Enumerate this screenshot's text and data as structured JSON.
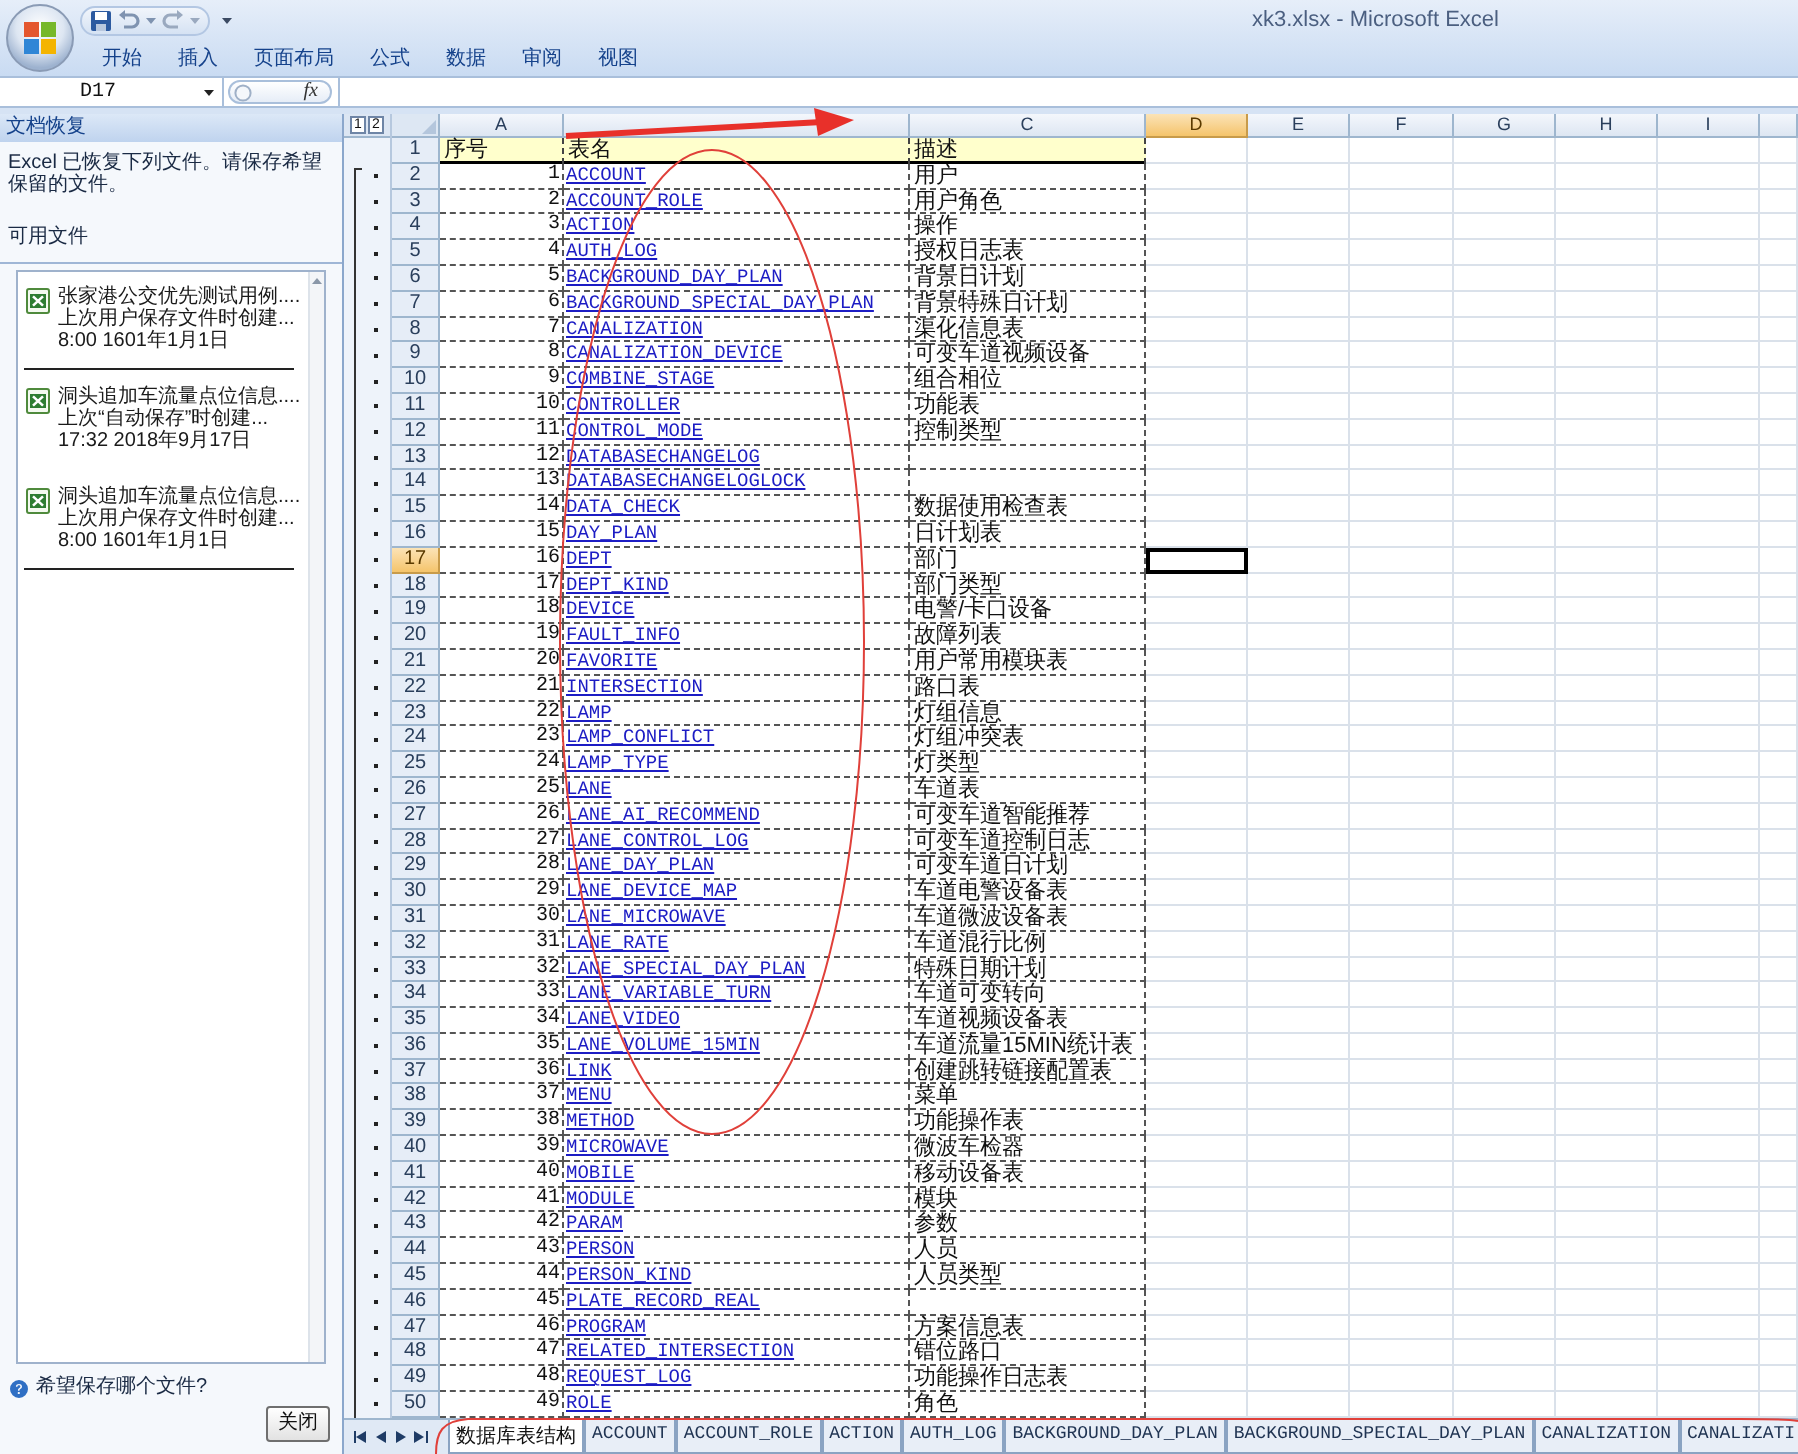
{
  "window": {
    "title": "xk3.xlsx - Microsoft Excel"
  },
  "ribbon_tabs": [
    {
      "label": "开始",
      "selected": false
    },
    {
      "label": "插入",
      "selected": false
    },
    {
      "label": "页面布局",
      "selected": false
    },
    {
      "label": "公式",
      "selected": false
    },
    {
      "label": "数据",
      "selected": false
    },
    {
      "label": "审阅",
      "selected": false
    },
    {
      "label": "视图",
      "selected": false
    }
  ],
  "formula_bar": {
    "name_box": "D17",
    "function_button": "fx"
  },
  "recovery_pane": {
    "title": "文档恢复",
    "message": "Excel 已恢复下列文件。请保存希望保留的文件。",
    "list_label": "可用文件",
    "files": [
      {
        "name": "张家港公交优先测试用例....",
        "status": "上次用户保存文件时创建...",
        "time": "8:00 1601年1月1日",
        "divider_after": true
      },
      {
        "name": "洞头追加车流量点位信息....",
        "status": "上次“自动保存”时创建...",
        "time": "17:32 2018年9月17日",
        "divider_after": false
      },
      {
        "name": "洞头追加车流量点位信息....",
        "status": "上次用户保存文件时创建...",
        "time": "8:00 1601年1月1日",
        "divider_after": true
      }
    ],
    "question": "希望保存哪个文件?",
    "close_button": "关闭"
  },
  "sheet": {
    "outline_levels": [
      "1",
      "2"
    ],
    "columns": [
      {
        "label": "A",
        "selected": false
      },
      {
        "selected": false
      },
      {
        "label": "C",
        "selected": false
      },
      {
        "label": "D",
        "selected": true
      },
      {
        "label": "E",
        "selected": false
      },
      {
        "label": "F",
        "selected": false
      },
      {
        "label": "G",
        "selected": false
      },
      {
        "label": "H",
        "selected": false
      },
      {
        "label": "I",
        "selected": false
      },
      {
        "selected": false
      }
    ],
    "rows": [
      {
        "number": "1",
        "selected": false,
        "kind": "header",
        "cells": [
          "序号",
          "表名",
          "描述"
        ]
      },
      {
        "number": "2",
        "selected": false,
        "kind": "data",
        "no": "1",
        "name": "ACCOUNT",
        "desc": "用户"
      },
      {
        "number": "3",
        "selected": false,
        "kind": "data",
        "no": "2",
        "name": "ACCOUNT_ROLE",
        "desc": "用户角色"
      },
      {
        "number": "4",
        "selected": false,
        "kind": "data",
        "no": "3",
        "name": "ACTION",
        "desc": "操作"
      },
      {
        "number": "5",
        "selected": false,
        "kind": "data",
        "no": "4",
        "name": "AUTH_LOG",
        "desc": "授权日志表"
      },
      {
        "number": "6",
        "selected": false,
        "kind": "data",
        "no": "5",
        "name": "BACKGROUND_DAY_PLAN",
        "desc": "背景日计划"
      },
      {
        "number": "7",
        "selected": false,
        "kind": "data",
        "no": "6",
        "name": "BACKGROUND_SPECIAL_DAY_PLAN",
        "desc": "背景特殊日计划"
      },
      {
        "number": "8",
        "selected": false,
        "kind": "data",
        "no": "7",
        "name": "CANALIZATION",
        "desc": "渠化信息表"
      },
      {
        "number": "9",
        "selected": false,
        "kind": "data",
        "no": "8",
        "name": "CANALIZATION_DEVICE",
        "desc": "可变车道视频设备"
      },
      {
        "number": "10",
        "selected": false,
        "kind": "data",
        "no": "9",
        "name": "COMBINE_STAGE",
        "desc": "组合相位"
      },
      {
        "number": "11",
        "selected": false,
        "kind": "data",
        "no": "10",
        "name": "CONTROLLER",
        "desc": "功能表"
      },
      {
        "number": "12",
        "selected": false,
        "kind": "data",
        "no": "11",
        "name": "CONTROL_MODE",
        "desc": "控制类型"
      },
      {
        "number": "13",
        "selected": false,
        "kind": "data",
        "no": "12",
        "name": "DATABASECHANGELOG"
      },
      {
        "number": "14",
        "selected": false,
        "kind": "data",
        "no": "13",
        "name": "DATABASECHANGELOGLOCK"
      },
      {
        "number": "15",
        "selected": false,
        "kind": "data",
        "no": "14",
        "name": "DATA_CHECK",
        "desc": "数据使用检查表"
      },
      {
        "number": "16",
        "selected": false,
        "kind": "data",
        "no": "15",
        "name": "DAY_PLAN",
        "desc": "日计划表"
      },
      {
        "number": "17",
        "selected": true,
        "kind": "data",
        "no": "16",
        "name": "DEPT",
        "desc": "部门"
      },
      {
        "number": "18",
        "selected": false,
        "kind": "data",
        "no": "17",
        "name": "DEPT_KIND",
        "desc": "部门类型"
      },
      {
        "number": "19",
        "selected": false,
        "kind": "data",
        "no": "18",
        "name": "DEVICE",
        "desc": "电警/卡口设备"
      },
      {
        "number": "20",
        "selected": false,
        "kind": "data",
        "no": "19",
        "name": "FAULT_INFO",
        "desc": "故障列表"
      },
      {
        "number": "21",
        "selected": false,
        "kind": "data",
        "no": "20",
        "name": "FAVORITE",
        "desc": "用户常用模块表"
      },
      {
        "number": "22",
        "selected": false,
        "kind": "data",
        "no": "21",
        "name": "INTERSECTION",
        "desc": "路口表"
      },
      {
        "number": "23",
        "selected": false,
        "kind": "data",
        "no": "22",
        "name": "LAMP",
        "desc": "灯组信息"
      },
      {
        "number": "24",
        "selected": false,
        "kind": "data",
        "no": "23",
        "name": "LAMP_CONFLICT",
        "desc": "灯组冲突表"
      },
      {
        "number": "25",
        "selected": false,
        "kind": "data",
        "no": "24",
        "name": "LAMP_TYPE",
        "desc": "灯类型"
      },
      {
        "number": "26",
        "selected": false,
        "kind": "data",
        "no": "25",
        "name": "LANE",
        "desc": "车道表"
      },
      {
        "number": "27",
        "selected": false,
        "kind": "data",
        "no": "26",
        "name": "LANE_AI_RECOMMEND",
        "desc": "可变车道智能推荐"
      },
      {
        "number": "28",
        "selected": false,
        "kind": "data",
        "no": "27",
        "name": "LANE_CONTROL_LOG",
        "desc": "可变车道控制日志"
      },
      {
        "number": "29",
        "selected": false,
        "kind": "data",
        "no": "28",
        "name": "LANE_DAY_PLAN",
        "desc": "可变车道日计划"
      },
      {
        "number": "30",
        "selected": false,
        "kind": "data",
        "no": "29",
        "name": "LANE_DEVICE_MAP",
        "desc": "车道电警设备表"
      },
      {
        "number": "31",
        "selected": false,
        "kind": "data",
        "no": "30",
        "name": "LANE_MICROWAVE",
        "desc": "车道微波设备表"
      },
      {
        "number": "32",
        "selected": false,
        "kind": "data",
        "no": "31",
        "name": "LANE_RATE",
        "desc": "车道混行比例"
      },
      {
        "number": "33",
        "selected": false,
        "kind": "data",
        "no": "32",
        "name": "LANE_SPECIAL_DAY_PLAN",
        "desc": "特殊日期计划"
      },
      {
        "number": "34",
        "selected": false,
        "kind": "data",
        "no": "33",
        "name": "LANE_VARIABLE_TURN",
        "desc": "车道可变转向"
      },
      {
        "number": "35",
        "selected": false,
        "kind": "data",
        "no": "34",
        "name": "LANE_VIDEO",
        "desc": "车道视频设备表"
      },
      {
        "number": "36",
        "selected": false,
        "kind": "data",
        "no": "35",
        "name": "LANE_VOLUME_15MIN",
        "desc": "车道流量15MIN统计表"
      },
      {
        "number": "37",
        "selected": false,
        "kind": "data",
        "no": "36",
        "name": "LINK",
        "desc": "创建跳转链接配置表"
      },
      {
        "number": "38",
        "selected": false,
        "kind": "data",
        "no": "37",
        "name": "MENU",
        "desc": "菜单"
      },
      {
        "number": "39",
        "selected": false,
        "kind": "data",
        "no": "38",
        "name": "METHOD",
        "desc": "功能操作表"
      },
      {
        "number": "40",
        "selected": false,
        "kind": "data",
        "no": "39",
        "name": "MICROWAVE",
        "desc": "微波车检器"
      },
      {
        "number": "41",
        "selected": false,
        "kind": "data",
        "no": "40",
        "name": "MOBILE",
        "desc": "移动设备表"
      },
      {
        "number": "42",
        "selected": false,
        "kind": "data",
        "no": "41",
        "name": "MODULE",
        "desc": "模块"
      },
      {
        "number": "43",
        "selected": false,
        "kind": "data",
        "no": "42",
        "name": "PARAM",
        "desc": "参数"
      },
      {
        "number": "44",
        "selected": false,
        "kind": "data",
        "no": "43",
        "name": "PERSON",
        "desc": "人员"
      },
      {
        "number": "45",
        "selected": false,
        "kind": "data",
        "no": "44",
        "name": "PERSON_KIND",
        "desc": "人员类型"
      },
      {
        "number": "46",
        "selected": false,
        "kind": "data",
        "no": "45",
        "name": "PLATE_RECORD_REAL"
      },
      {
        "number": "47",
        "selected": false,
        "kind": "data",
        "no": "46",
        "name": "PROGRAM",
        "desc": "方案信息表"
      },
      {
        "number": "48",
        "selected": false,
        "kind": "data",
        "no": "47",
        "name": "RELATED_INTERSECTION",
        "desc": "错位路口"
      },
      {
        "number": "49",
        "selected": false,
        "kind": "data",
        "no": "48",
        "name": "REQUEST_LOG",
        "desc": "功能操作日志表"
      },
      {
        "number": "50",
        "selected": false,
        "kind": "data",
        "no": "49",
        "name": "ROLE",
        "desc": "角色"
      }
    ]
  },
  "sheet_tabs": [
    {
      "label": "数据库表结构",
      "selected": true
    },
    {
      "label": "ACCOUNT",
      "selected": false
    },
    {
      "label": "ACCOUNT_ROLE",
      "selected": false
    },
    {
      "label": "ACTION",
      "selected": false
    },
    {
      "label": "AUTH_LOG",
      "selected": false
    },
    {
      "label": "BACKGROUND_DAY_PLAN",
      "selected": false
    },
    {
      "label": "BACKGROUND_SPECIAL_DAY_PLAN",
      "selected": false
    },
    {
      "label": "CANALIZATION",
      "selected": false
    },
    {
      "label": "CANALIZATI",
      "selected": false
    }
  ]
}
